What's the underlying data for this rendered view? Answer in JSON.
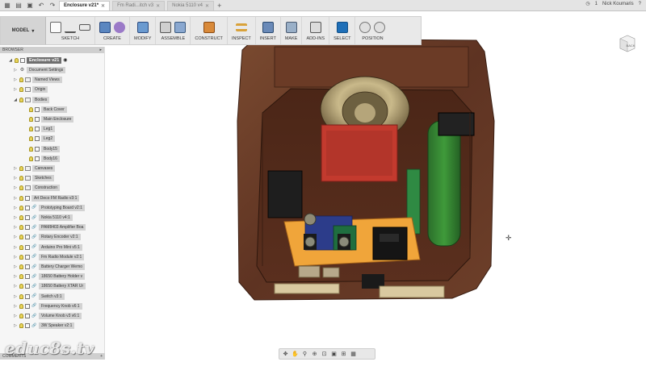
{
  "tabs": [
    {
      "label": "Enclosure v21*",
      "active": true
    },
    {
      "label": "Fm Radi...itch v3",
      "active": false
    },
    {
      "label": "Nokia 5110 v4",
      "active": false
    }
  ],
  "user": {
    "name": "Nick Koumaris",
    "notifications": "1"
  },
  "toolbar": {
    "workspace": "MODEL",
    "groups": [
      "SKETCH",
      "CREATE",
      "MODIFY",
      "ASSEMBLE",
      "CONSTRUCT",
      "INSPECT",
      "INSERT",
      "MAKE",
      "ADD-INS",
      "SELECT",
      "POSITION"
    ]
  },
  "viewcube": {
    "label": "BACK"
  },
  "browser": {
    "title": "BROWSER",
    "root": "Enclosure v21",
    "rows": [
      {
        "label": "Document Settings",
        "type": "gear",
        "indent": 1
      },
      {
        "label": "Named Views",
        "type": "folder",
        "indent": 1
      },
      {
        "label": "Origin",
        "type": "folder",
        "indent": 1
      },
      {
        "label": "Bodies",
        "type": "folder",
        "indent": 1,
        "expanded": true
      },
      {
        "label": "Back Cover",
        "type": "body",
        "indent": 2
      },
      {
        "label": "Main Enclosure",
        "type": "body",
        "indent": 2
      },
      {
        "label": "Leg1",
        "type": "body",
        "indent": 2
      },
      {
        "label": "Leg2",
        "type": "body",
        "indent": 2
      },
      {
        "label": "Body15",
        "type": "body",
        "indent": 2
      },
      {
        "label": "Body16",
        "type": "body",
        "indent": 2
      },
      {
        "label": "Canvases",
        "type": "folder",
        "indent": 1
      },
      {
        "label": "Sketches",
        "type": "folder",
        "indent": 1
      },
      {
        "label": "Construction",
        "type": "folder",
        "indent": 1
      },
      {
        "label": "Art Deco FM Radio v3:1",
        "type": "component",
        "indent": 1
      },
      {
        "label": "Prototyping Board v2:1",
        "type": "link",
        "indent": 1
      },
      {
        "label": "Nokia 5110 v4:1",
        "type": "link",
        "indent": 1
      },
      {
        "label": "PAM8403 Amplifier Boa",
        "type": "link",
        "indent": 1
      },
      {
        "label": "Rotary Encoder v2:1",
        "type": "link",
        "indent": 1
      },
      {
        "label": "Arduino Pro Mini v5:1",
        "type": "link",
        "indent": 1
      },
      {
        "label": "Fm Radio Module v2:1",
        "type": "link",
        "indent": 1
      },
      {
        "label": "Battery Charger Wemo",
        "type": "link",
        "indent": 1
      },
      {
        "label": "18650 Battery Holder v",
        "type": "link",
        "indent": 1
      },
      {
        "label": "18650 Battery XTAR Ur",
        "type": "link",
        "indent": 1
      },
      {
        "label": "Switch v3:1",
        "type": "link",
        "indent": 1
      },
      {
        "label": "Frequency Knob v6:1",
        "type": "link",
        "indent": 1
      },
      {
        "label": "Volume Knob v3 v6:1",
        "type": "link",
        "indent": 1
      },
      {
        "label": "3W Speaker v2:1",
        "type": "link",
        "indent": 1
      }
    ]
  },
  "comments": {
    "title": "COMMENTS"
  },
  "watermark": "educ8s.tv"
}
